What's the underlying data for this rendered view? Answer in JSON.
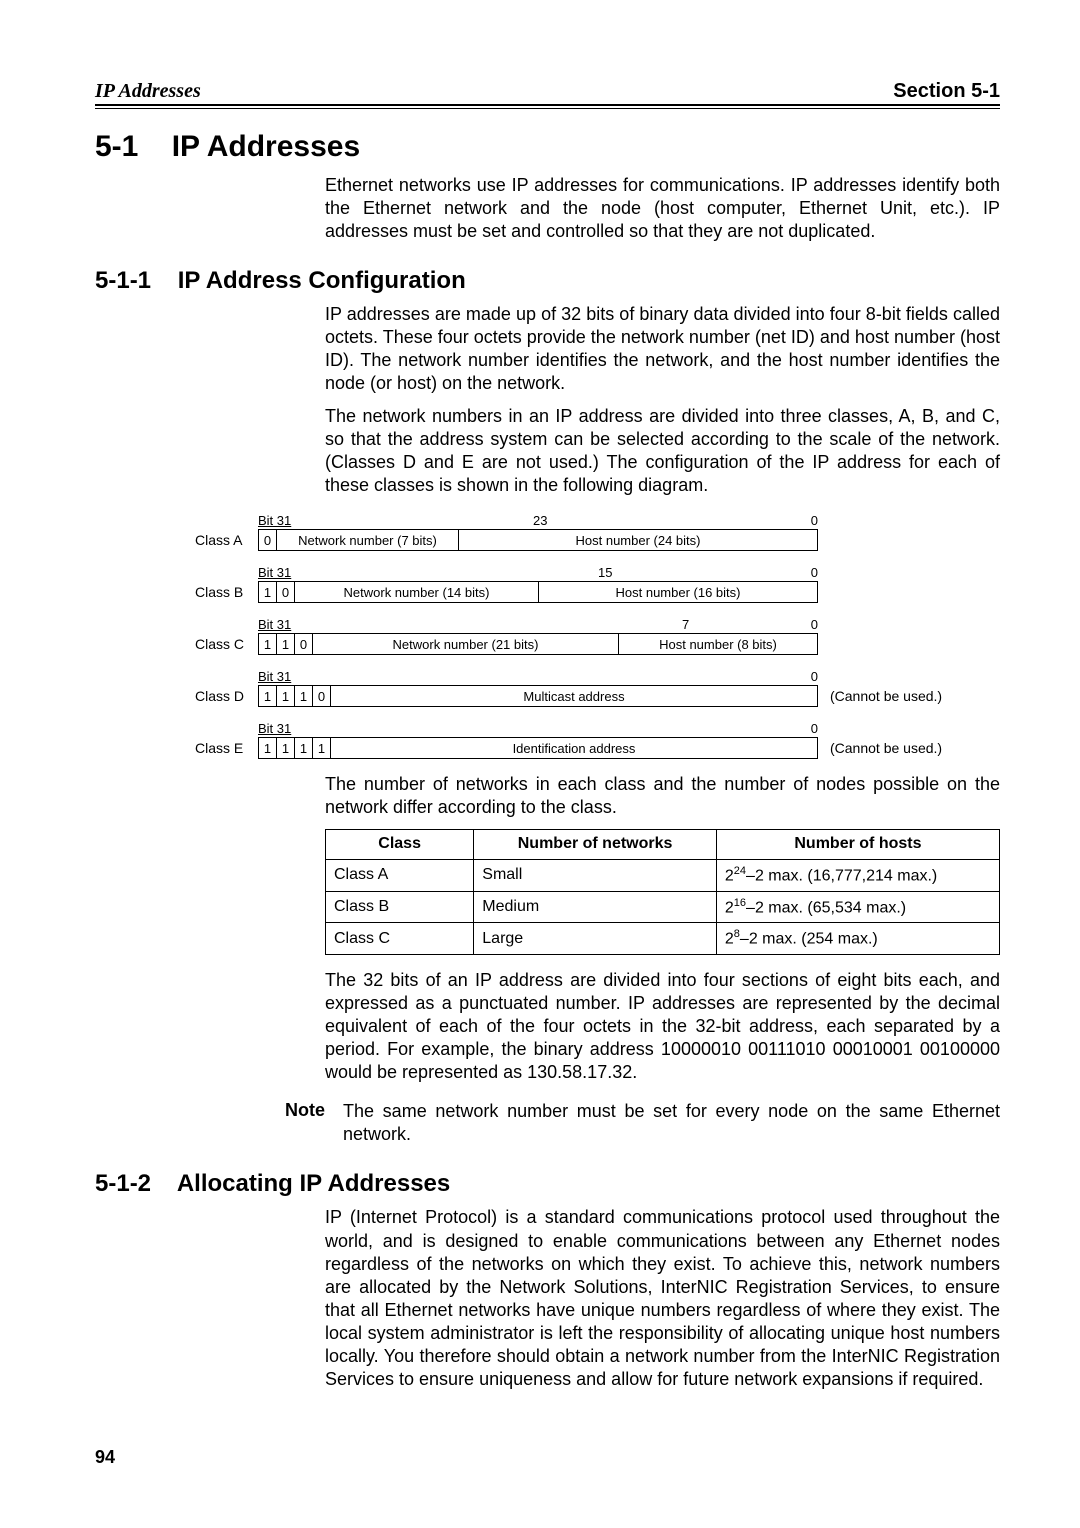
{
  "header": {
    "left": "IP Addresses",
    "right": "Section 5-1"
  },
  "s1": {
    "num": "5-1",
    "title": "IP Addresses",
    "intro": "Ethernet networks use IP addresses for communications. IP addresses identify both the Ethernet network and the node (host computer, Ethernet Unit, etc.). IP addresses must be set and controlled so that they are not duplicated."
  },
  "s11": {
    "num": "5-1-1",
    "title": "IP Address Configuration",
    "p1": "IP addresses are made up of 32 bits of binary data divided into four 8-bit fields called octets. These four octets provide the network number (net ID) and host number (host ID). The network number identifies the network, and the host number identifies the node (or host) on the network.",
    "p2": "The network numbers in an IP address are divided into three classes, A, B, and C, so that the address system can be selected according to the scale of the network. (Classes D and E are not used.) The configuration of the IP address for each of these classes is shown in the following diagram."
  },
  "diagram": {
    "bit31": "Bit 31",
    "zero": "0",
    "cannot": "(Cannot be used.)",
    "classA": {
      "label": "Class A",
      "tick_mid": "23",
      "bits": [
        "0"
      ],
      "net": "Network number (7 bits)",
      "host": "Host number (24 bits)"
    },
    "classB": {
      "label": "Class B",
      "tick_mid": "15",
      "bits": [
        "1",
        "0"
      ],
      "net": "Network number (14 bits)",
      "host": "Host number (16 bits)"
    },
    "classC": {
      "label": "Class C",
      "tick_mid": "7",
      "bits": [
        "1",
        "1",
        "0"
      ],
      "net": "Network number (21 bits)",
      "host": "Host number (8 bits)"
    },
    "classD": {
      "label": "Class D",
      "bits": [
        "1",
        "1",
        "1",
        "0"
      ],
      "body": "Multicast address"
    },
    "classE": {
      "label": "Class E",
      "bits": [
        "1",
        "1",
        "1",
        "1"
      ],
      "body": "Identification address"
    }
  },
  "afterdiag": "The number of networks in each class and the number of nodes possible on the network differ according to the class.",
  "table": {
    "h1": "Class",
    "h2": "Number of networks",
    "h3": "Number of hosts",
    "rows": [
      {
        "c1": "Class A",
        "c2": "Small",
        "exp": "24",
        "rest": "–2 max. (16,777,214 max.)"
      },
      {
        "c1": "Class B",
        "c2": "Medium",
        "exp": "16",
        "rest": "–2 max. (65,534 max.)"
      },
      {
        "c1": "Class C",
        "c2": "Large",
        "exp": "8",
        "rest": "–2 max. (254 max.)"
      }
    ]
  },
  "p_bits": "The 32 bits of an IP address are divided into four sections of eight bits each, and expressed as a punctuated number. IP addresses are represented by the decimal equivalent of each of the four octets in the 32-bit address, each separated by a period. For example, the binary address 10000010 00111010 00010001 00100000 would be represented as 130.58.17.32.",
  "note": {
    "label": "Note",
    "text": "The same network number must be set for every node on the same Ethernet network."
  },
  "s12": {
    "num": "5-1-2",
    "title": "Allocating IP Addresses",
    "p": "IP (Internet Protocol) is a standard communications protocol used throughout the world, and is designed to enable communications between any Ethernet nodes regardless of the networks on which they exist. To achieve this, network numbers are allocated by the Network Solutions, InterNIC Registration Services, to ensure that all Ethernet networks have unique numbers regardless of where they exist. The local system administrator is left the responsibility of allocating unique host numbers locally. You therefore should obtain a network number from the InterNIC Registration Services to ensure uniqueness and allow for future network expansions if required."
  },
  "page": "94"
}
